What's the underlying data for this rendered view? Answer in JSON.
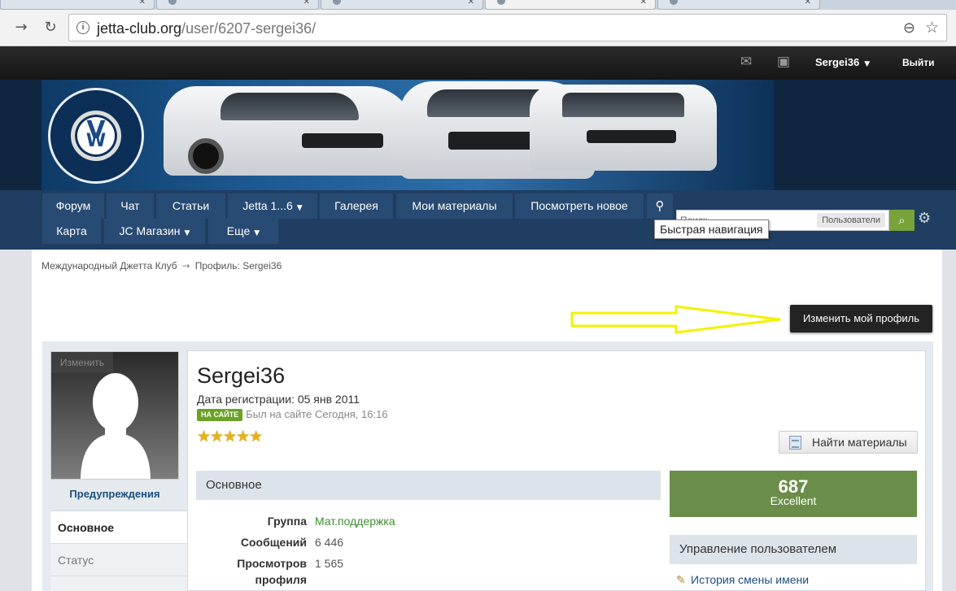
{
  "browser": {
    "url_domain": "jetta-club.org",
    "url_path": "/user/6207-sergei36/"
  },
  "userbar": {
    "username": "Sergei36",
    "logout": "Выйти"
  },
  "nav": {
    "row1": [
      {
        "label": "Форум"
      },
      {
        "label": "Чат"
      },
      {
        "label": "Статьи"
      },
      {
        "label": "Jetta 1...6"
      },
      {
        "label": "Галерея"
      },
      {
        "label": "Мои материалы"
      },
      {
        "label": "Посмотреть новое"
      }
    ],
    "row2": [
      {
        "label": "Карта"
      },
      {
        "label": "JC Магазин"
      },
      {
        "label": "Еще"
      }
    ],
    "search_placeholder": "Поиск...",
    "search_scope": "Пользователи",
    "tooltip": "Быстрая навигация"
  },
  "breadcrumb": {
    "root": "Международный Джетта Клуб",
    "current": "Профиль: Sergei36"
  },
  "edit_profile_button": "Изменить мой профиль",
  "profile": {
    "avatar_edit": "Изменить",
    "warnings": "Предупреждения",
    "tabs": [
      "Основное",
      "Статус"
    ],
    "name": "Sergei36",
    "registration": "Дата регистрации: 05 янв 2011",
    "online_badge": "НА САЙТЕ",
    "last_seen": "Был на сайте Сегодня, 16:16",
    "stars": "★★★★★",
    "find_button": "Найти материалы",
    "section_title": "Основное",
    "fields": [
      {
        "label": "Группа",
        "value": "Мат.поддержка"
      },
      {
        "label": "Сообщений",
        "value": "6 446"
      },
      {
        "label": "Просмотров профиля",
        "value": "1 565"
      }
    ],
    "reputation_value": "687",
    "reputation_label": "Excellent",
    "management_title": "Управление пользователем",
    "management_items": [
      "История смены имени"
    ]
  }
}
